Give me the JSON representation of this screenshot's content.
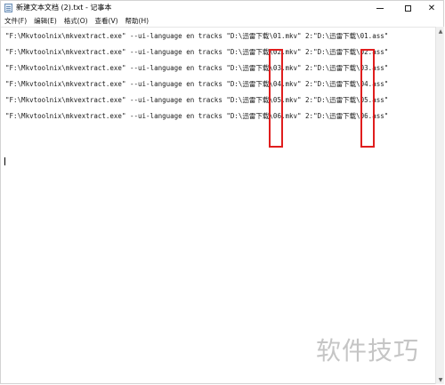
{
  "window": {
    "title": "新建文本文档 (2).txt - 记事本",
    "minimize_symbol": "",
    "close_symbol": "✕"
  },
  "menu": [
    "文件(F)",
    "编辑(E)",
    "格式(O)",
    "查看(V)",
    "帮助(H)"
  ],
  "document_lines": [
    "\"F:\\Mkvtoolnix\\mkvextract.exe\" --ui-language en tracks \"D:\\迅雷下载\\01.mkv\" 2:\"D:\\迅雷下载\\01.ass\"",
    "\"F:\\Mkvtoolnix\\mkvextract.exe\" --ui-language en tracks \"D:\\迅雷下载\\02.mkv\" 2:\"D:\\迅雷下载\\02.ass\"",
    "\"F:\\Mkvtoolnix\\mkvextract.exe\" --ui-language en tracks \"D:\\迅雷下载\\03.mkv\" 2:\"D:\\迅雷下载\\03.ass\"",
    "\"F:\\Mkvtoolnix\\mkvextract.exe\" --ui-language en tracks \"D:\\迅雷下载\\04.mkv\" 2:\"D:\\迅雷下载\\04.ass\"",
    "\"F:\\Mkvtoolnix\\mkvextract.exe\" --ui-language en tracks \"D:\\迅雷下载\\05.mkv\" 2:\"D:\\迅雷下载\\05.ass\"",
    "\"F:\\Mkvtoolnix\\mkvextract.exe\" --ui-language en tracks \"D:\\迅雷下载\\06.mkv\" 2:\"D:\\迅雷下载\\06.ass\""
  ],
  "scrollbar": {
    "up_arrow": "▲",
    "down_arrow": "▼"
  },
  "annotation": {
    "color": "#e01e1e"
  },
  "watermark": "软件技巧"
}
